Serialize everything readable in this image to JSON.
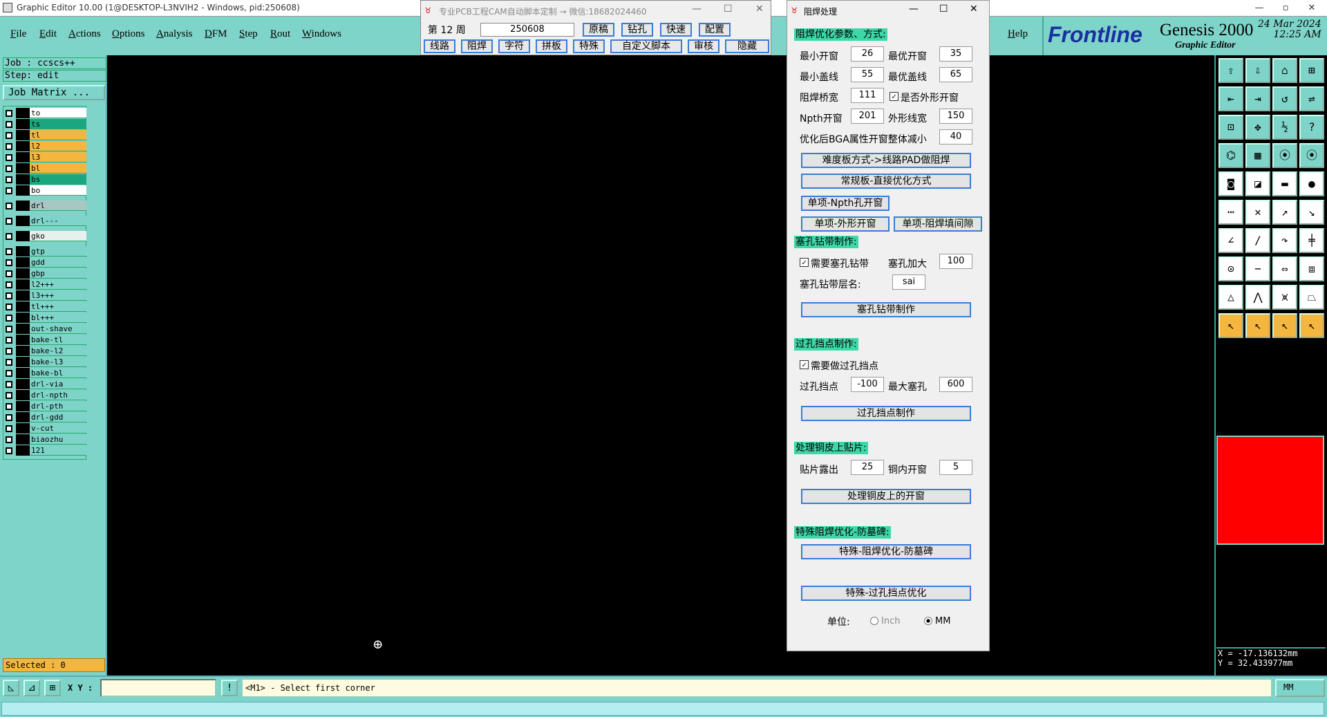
{
  "titlebar": {
    "title": "Graphic Editor 10.00 (1@DESKTOP-L3NVIH2 - Windows, pid:250608)"
  },
  "menu": [
    "File",
    "Edit",
    "Actions",
    "Options",
    "Analysis",
    "DFM",
    "Step",
    "Rout",
    "Windows"
  ],
  "help": "Help",
  "logo": {
    "brand": "Frontline",
    "product": "Genesis 2000",
    "subtitle": "Graphic Editor",
    "date": "24 Mar 2024",
    "time": "12:25 AM"
  },
  "job": {
    "job": "Job : ccscs++",
    "step": "Step: edit",
    "matrix": "Job Matrix ..."
  },
  "layers": [
    {
      "name": "to",
      "color": "#ffffff"
    },
    {
      "name": "ts",
      "color": "#1aa67f"
    },
    {
      "name": "tl",
      "color": "#f4b63e"
    },
    {
      "name": "l2",
      "color": "#f4b63e"
    },
    {
      "name": "l3",
      "color": "#f4b63e"
    },
    {
      "name": "bl",
      "color": "#f4b63e"
    },
    {
      "name": "bs",
      "color": "#1aa67f"
    },
    {
      "name": "bo",
      "color": "#ffffff"
    },
    {
      "name": "drl",
      "color": "#a9c6c3"
    },
    {
      "name": "drl---",
      "color": "#7fd4c9"
    },
    {
      "name": "gko",
      "color": "#e8f0ee"
    },
    {
      "name": "gtp",
      "color": "#7fd4c9"
    },
    {
      "name": "gdd",
      "color": "#7fd4c9"
    },
    {
      "name": "gbp",
      "color": "#7fd4c9"
    },
    {
      "name": "l2+++",
      "color": "#7fd4c9"
    },
    {
      "name": "l3+++",
      "color": "#7fd4c9"
    },
    {
      "name": "tl+++",
      "color": "#7fd4c9"
    },
    {
      "name": "bl+++",
      "color": "#7fd4c9"
    },
    {
      "name": "out-shave",
      "color": "#7fd4c9"
    },
    {
      "name": "bake-tl",
      "color": "#7fd4c9"
    },
    {
      "name": "bake-l2",
      "color": "#7fd4c9"
    },
    {
      "name": "bake-l3",
      "color": "#7fd4c9"
    },
    {
      "name": "bake-bl",
      "color": "#7fd4c9"
    },
    {
      "name": "drl-via",
      "color": "#7fd4c9"
    },
    {
      "name": "drl-npth",
      "color": "#7fd4c9"
    },
    {
      "name": "drl-pth",
      "color": "#7fd4c9"
    },
    {
      "name": "drl-gdd",
      "color": "#7fd4c9"
    },
    {
      "name": "v-cut",
      "color": "#7fd4c9"
    },
    {
      "name": "biaozhu",
      "color": "#7fd4c9"
    },
    {
      "name": "121",
      "color": "#7fd4c9"
    }
  ],
  "status": {
    "selected": "Selected : 0",
    "xy_label": "X Y :",
    "message": "<M1> - Select first corner",
    "unit": "MM",
    "coords_x": "X = -17.136132mm",
    "coords_y": "Y = 32.433977mm"
  },
  "toolwin": {
    "title": "专业PCB工程CAM自动脚本定制 → 微信:18682024460",
    "week_label": "第 12 周",
    "week_value": "250608",
    "row1": [
      "原稿",
      "钻孔",
      "快速",
      "配置"
    ],
    "row2": [
      "线路",
      "阻焊",
      "字符",
      "拼板",
      "特殊",
      "自定义脚本",
      "审核",
      "隐藏"
    ]
  },
  "dialog": {
    "title": "阻焊处理",
    "sec1": "阻焊优化参数、方式:",
    "min_open": "最小开窗",
    "min_open_v": "26",
    "best_open": "最优开窗",
    "best_open_v": "35",
    "min_cover": "最小盖线",
    "min_cover_v": "55",
    "best_cover": "最优盖线",
    "best_cover_v": "65",
    "bridge": "阻焊桥宽",
    "bridge_v": "111",
    "outline_open": "是否外形开窗",
    "npth": "Npth开窗",
    "npth_v": "201",
    "outline_w": "外形线宽",
    "outline_w_v": "150",
    "bga": "优化后BGA属性开窗整体减小",
    "bga_v": "40",
    "btn_hard": "难度板方式->线路PAD做阻焊",
    "btn_normal": "常规板-直接优化方式",
    "btn_npth": "单项-Npth孔开窗",
    "btn_outline": "单项-外形开窗",
    "btn_fill": "单项-阻焊填间隙",
    "sec2": "塞孔钻带制作:",
    "need_plug": "需要塞孔钻带",
    "plug_add": "塞孔加大",
    "plug_add_v": "100",
    "plug_layer": "塞孔钻带层名:",
    "plug_layer_v": "sai",
    "btn_plug": "塞孔钻带制作",
    "sec3": "过孔挡点制作:",
    "need_via": "需要做过孔挡点",
    "via_dot": "过孔挡点",
    "via_dot_v": "-100",
    "max_plug": "最大塞孔",
    "max_plug_v": "600",
    "btn_via": "过孔挡点制作",
    "sec4": "处理铜皮上贴片:",
    "smd_expose": "贴片露出",
    "smd_expose_v": "25",
    "cu_open": "铜内开窗",
    "cu_open_v": "5",
    "btn_cu": "处理铜皮上的开窗",
    "sec5": "特殊阻焊优化-防墓碑:",
    "btn_tomb": "特殊-阻焊优化-防墓碑",
    "btn_via_opt": "特殊-过孔挡点优化",
    "unit_label": "单位:",
    "unit_inch": "Inch",
    "unit_mm": "MM"
  }
}
